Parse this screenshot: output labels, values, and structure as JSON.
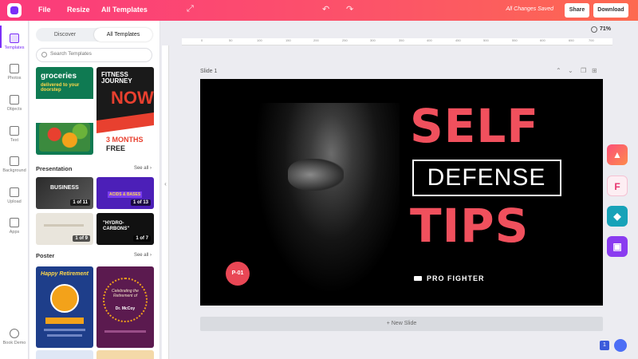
{
  "topbar": {
    "menu": [
      "File",
      "Resize",
      "All Templates"
    ],
    "status": "All Changes Saved",
    "share_label": "Share",
    "download_label": "Download"
  },
  "rail": {
    "items": [
      {
        "label": "Templates",
        "icon": "templates-icon"
      },
      {
        "label": "Photos",
        "icon": "photo-icon"
      },
      {
        "label": "Objects",
        "icon": "objects-icon"
      },
      {
        "label": "Text",
        "icon": "text-icon"
      },
      {
        "label": "Background",
        "icon": "background-icon"
      },
      {
        "label": "Upload",
        "icon": "upload-icon"
      },
      {
        "label": "Apps",
        "icon": "apps-icon"
      }
    ],
    "book_demo": "Book Demo"
  },
  "panel": {
    "tabs": [
      "Discover",
      "All Templates"
    ],
    "search_placeholder": "Search Templates",
    "top_thumbs": {
      "left": {
        "title": "groceries",
        "sub": "delivered to your doorstep"
      },
      "right": {
        "title1": "FITNESS",
        "title2": "JOURNEY",
        "title3": "NOW",
        "promo": "3 MONTHS",
        "promo2": "FREE"
      }
    },
    "presentation": {
      "title": "Presentation",
      "see_all": "See all",
      "items": [
        {
          "caption": "BUSINESS",
          "pages": "1 of 11"
        },
        {
          "caption": "ACIDS & BASES",
          "pages": "1 of 13"
        },
        {
          "caption": "",
          "pages": "1 of 9"
        },
        {
          "caption": "\"HYDRO-CARBONS\"",
          "pages": "1 of 7"
        }
      ]
    },
    "poster": {
      "title": "Poster",
      "see_all": "See all",
      "items": [
        {
          "caption": "Happy Retirement"
        },
        {
          "caption": "Celebrating the Retirement of",
          "name": "Dr. McCoy"
        }
      ]
    }
  },
  "canvas": {
    "zoom": "71%",
    "slide_label": "Slide 1",
    "new_slide": "+ New Slide",
    "slide": {
      "title_top": "SELF",
      "title_mid": "DEFENSE",
      "title_bottom": "TIPS",
      "tagline": "PRO FIGHTER",
      "page_tag": "P-01"
    },
    "ruler_ticks": [
      "0",
      "50",
      "100",
      "150",
      "200",
      "250",
      "300",
      "350",
      "400",
      "450",
      "500",
      "550",
      "600",
      "650",
      "700",
      "750"
    ]
  },
  "colors": {
    "accent": "#7b2ff7",
    "topbar_start": "#fb3a7c",
    "topbar_end": "#fd6a4f",
    "slide_red": "#f0505d"
  }
}
